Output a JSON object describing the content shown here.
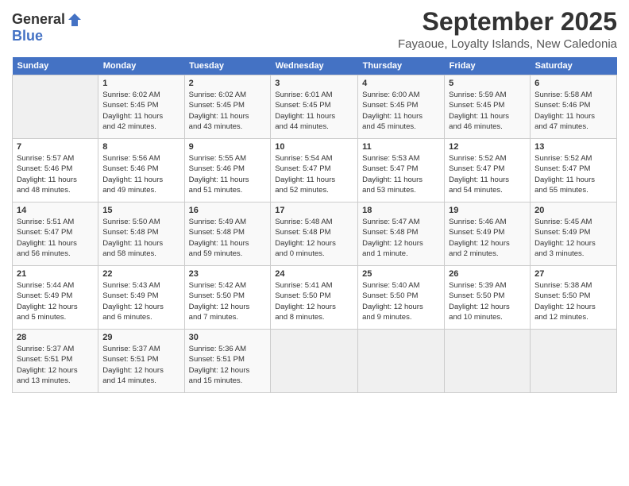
{
  "logo": {
    "general": "General",
    "blue": "Blue"
  },
  "header": {
    "title": "September 2025",
    "subtitle": "Fayaoue, Loyalty Islands, New Caledonia"
  },
  "days_header": [
    "Sunday",
    "Monday",
    "Tuesday",
    "Wednesday",
    "Thursday",
    "Friday",
    "Saturday"
  ],
  "weeks": [
    [
      {
        "num": "",
        "info": ""
      },
      {
        "num": "1",
        "info": "Sunrise: 6:02 AM\nSunset: 5:45 PM\nDaylight: 11 hours\nand 42 minutes."
      },
      {
        "num": "2",
        "info": "Sunrise: 6:02 AM\nSunset: 5:45 PM\nDaylight: 11 hours\nand 43 minutes."
      },
      {
        "num": "3",
        "info": "Sunrise: 6:01 AM\nSunset: 5:45 PM\nDaylight: 11 hours\nand 44 minutes."
      },
      {
        "num": "4",
        "info": "Sunrise: 6:00 AM\nSunset: 5:45 PM\nDaylight: 11 hours\nand 45 minutes."
      },
      {
        "num": "5",
        "info": "Sunrise: 5:59 AM\nSunset: 5:45 PM\nDaylight: 11 hours\nand 46 minutes."
      },
      {
        "num": "6",
        "info": "Sunrise: 5:58 AM\nSunset: 5:46 PM\nDaylight: 11 hours\nand 47 minutes."
      }
    ],
    [
      {
        "num": "7",
        "info": "Sunrise: 5:57 AM\nSunset: 5:46 PM\nDaylight: 11 hours\nand 48 minutes."
      },
      {
        "num": "8",
        "info": "Sunrise: 5:56 AM\nSunset: 5:46 PM\nDaylight: 11 hours\nand 49 minutes."
      },
      {
        "num": "9",
        "info": "Sunrise: 5:55 AM\nSunset: 5:46 PM\nDaylight: 11 hours\nand 51 minutes."
      },
      {
        "num": "10",
        "info": "Sunrise: 5:54 AM\nSunset: 5:47 PM\nDaylight: 11 hours\nand 52 minutes."
      },
      {
        "num": "11",
        "info": "Sunrise: 5:53 AM\nSunset: 5:47 PM\nDaylight: 11 hours\nand 53 minutes."
      },
      {
        "num": "12",
        "info": "Sunrise: 5:52 AM\nSunset: 5:47 PM\nDaylight: 11 hours\nand 54 minutes."
      },
      {
        "num": "13",
        "info": "Sunrise: 5:52 AM\nSunset: 5:47 PM\nDaylight: 11 hours\nand 55 minutes."
      }
    ],
    [
      {
        "num": "14",
        "info": "Sunrise: 5:51 AM\nSunset: 5:47 PM\nDaylight: 11 hours\nand 56 minutes."
      },
      {
        "num": "15",
        "info": "Sunrise: 5:50 AM\nSunset: 5:48 PM\nDaylight: 11 hours\nand 58 minutes."
      },
      {
        "num": "16",
        "info": "Sunrise: 5:49 AM\nSunset: 5:48 PM\nDaylight: 11 hours\nand 59 minutes."
      },
      {
        "num": "17",
        "info": "Sunrise: 5:48 AM\nSunset: 5:48 PM\nDaylight: 12 hours\nand 0 minutes."
      },
      {
        "num": "18",
        "info": "Sunrise: 5:47 AM\nSunset: 5:48 PM\nDaylight: 12 hours\nand 1 minute."
      },
      {
        "num": "19",
        "info": "Sunrise: 5:46 AM\nSunset: 5:49 PM\nDaylight: 12 hours\nand 2 minutes."
      },
      {
        "num": "20",
        "info": "Sunrise: 5:45 AM\nSunset: 5:49 PM\nDaylight: 12 hours\nand 3 minutes."
      }
    ],
    [
      {
        "num": "21",
        "info": "Sunrise: 5:44 AM\nSunset: 5:49 PM\nDaylight: 12 hours\nand 5 minutes."
      },
      {
        "num": "22",
        "info": "Sunrise: 5:43 AM\nSunset: 5:49 PM\nDaylight: 12 hours\nand 6 minutes."
      },
      {
        "num": "23",
        "info": "Sunrise: 5:42 AM\nSunset: 5:50 PM\nDaylight: 12 hours\nand 7 minutes."
      },
      {
        "num": "24",
        "info": "Sunrise: 5:41 AM\nSunset: 5:50 PM\nDaylight: 12 hours\nand 8 minutes."
      },
      {
        "num": "25",
        "info": "Sunrise: 5:40 AM\nSunset: 5:50 PM\nDaylight: 12 hours\nand 9 minutes."
      },
      {
        "num": "26",
        "info": "Sunrise: 5:39 AM\nSunset: 5:50 PM\nDaylight: 12 hours\nand 10 minutes."
      },
      {
        "num": "27",
        "info": "Sunrise: 5:38 AM\nSunset: 5:50 PM\nDaylight: 12 hours\nand 12 minutes."
      }
    ],
    [
      {
        "num": "28",
        "info": "Sunrise: 5:37 AM\nSunset: 5:51 PM\nDaylight: 12 hours\nand 13 minutes."
      },
      {
        "num": "29",
        "info": "Sunrise: 5:37 AM\nSunset: 5:51 PM\nDaylight: 12 hours\nand 14 minutes."
      },
      {
        "num": "30",
        "info": "Sunrise: 5:36 AM\nSunset: 5:51 PM\nDaylight: 12 hours\nand 15 minutes."
      },
      {
        "num": "",
        "info": ""
      },
      {
        "num": "",
        "info": ""
      },
      {
        "num": "",
        "info": ""
      },
      {
        "num": "",
        "info": ""
      }
    ]
  ]
}
